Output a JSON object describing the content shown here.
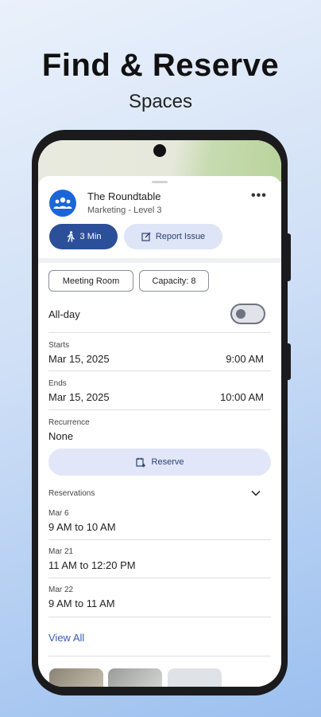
{
  "hero": {
    "title": "Find & Reserve",
    "subtitle": "Spaces"
  },
  "room": {
    "name": "The Roundtable",
    "location": "Marketing - Level 3"
  },
  "actions": {
    "walk_label": "3 Min",
    "report_label": "Report Issue"
  },
  "chips": [
    "Meeting Room",
    "Capacity: 8"
  ],
  "allday": {
    "label": "All-day",
    "enabled": false
  },
  "starts": {
    "label": "Starts",
    "date": "Mar 15, 2025",
    "time": "9:00 AM"
  },
  "ends": {
    "label": "Ends",
    "date": "Mar 15, 2025",
    "time": "10:00 AM"
  },
  "recurrence": {
    "label": "Recurrence",
    "value": "None"
  },
  "reserve_label": "Reserve",
  "reservations": {
    "header": "Reservations",
    "items": [
      {
        "date": "Mar 6",
        "time": "9 AM to 10 AM"
      },
      {
        "date": "Mar 21",
        "time": "11 AM to 12:20 PM"
      },
      {
        "date": "Mar 22",
        "time": "9 AM to 11 AM"
      }
    ],
    "view_all": "View All"
  },
  "colors": {
    "primary": "#2c4f9a",
    "avatar": "#1a66d9",
    "tonal": "#dde5f6",
    "link": "#3b5bb5"
  }
}
